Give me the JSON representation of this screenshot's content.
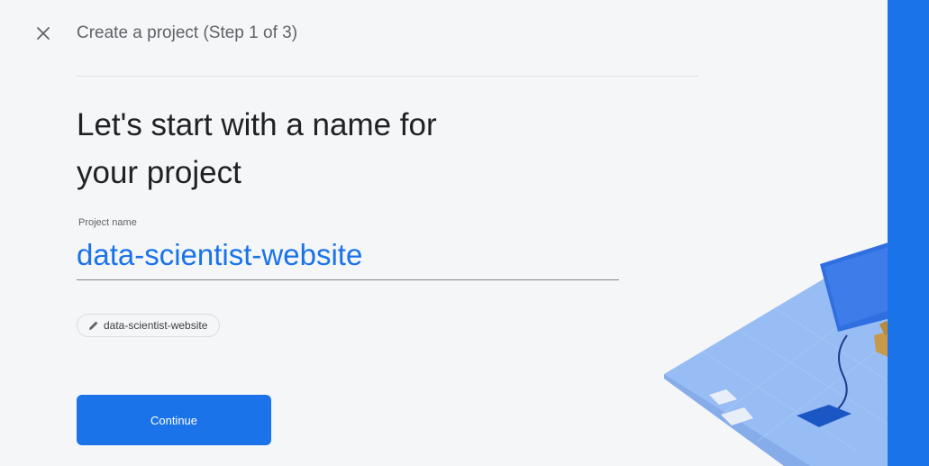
{
  "header": {
    "close_icon": "close-icon",
    "title": "Create a project (Step 1 of 3)"
  },
  "main": {
    "heading_line1": "Let's start with a name for",
    "heading_line2": "your project",
    "project_name": {
      "label": "Project name",
      "value": "data-scientist-website"
    },
    "project_id_chip": {
      "icon": "pencil-icon",
      "value": "data-scientist-website"
    },
    "continue_label": "Continue"
  },
  "colors": {
    "accent": "#1a73e8",
    "background": "#f5f6f8",
    "text_primary": "#202124",
    "text_secondary": "#5f6368"
  }
}
